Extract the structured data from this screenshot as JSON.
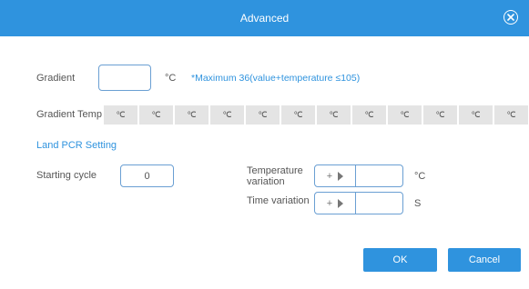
{
  "dialog": {
    "title": "Advanced",
    "close_icon": "close-circle-icon"
  },
  "gradient": {
    "label": "Gradient",
    "value": "",
    "unit": "°C",
    "note": "*Maximum 36(value+temperature ≤105)"
  },
  "gradient_temp": {
    "label": "Gradient Temp",
    "cells": [
      "℃",
      "℃",
      "℃",
      "℃",
      "℃",
      "℃",
      "℃",
      "℃",
      "℃",
      "℃",
      "℃",
      "℃",
      "℃"
    ]
  },
  "land_pcr": {
    "section_title": "Land PCR Setting",
    "starting_cycle_label": "Starting cycle",
    "starting_cycle_value": "0",
    "temperature_variation_label_line1": "Temperature",
    "temperature_variation_label_line2": "variation",
    "temperature_sign": "+",
    "temperature_value": "",
    "temperature_unit": "°C",
    "time_variation_label": "Time variation",
    "time_sign": "+",
    "time_value": "",
    "time_unit": "S"
  },
  "buttons": {
    "ok": "OK",
    "cancel": "Cancel"
  },
  "colors": {
    "accent": "#2f93de",
    "cell_bg": "#e4e4e4",
    "input_border": "#6a9fd3"
  }
}
